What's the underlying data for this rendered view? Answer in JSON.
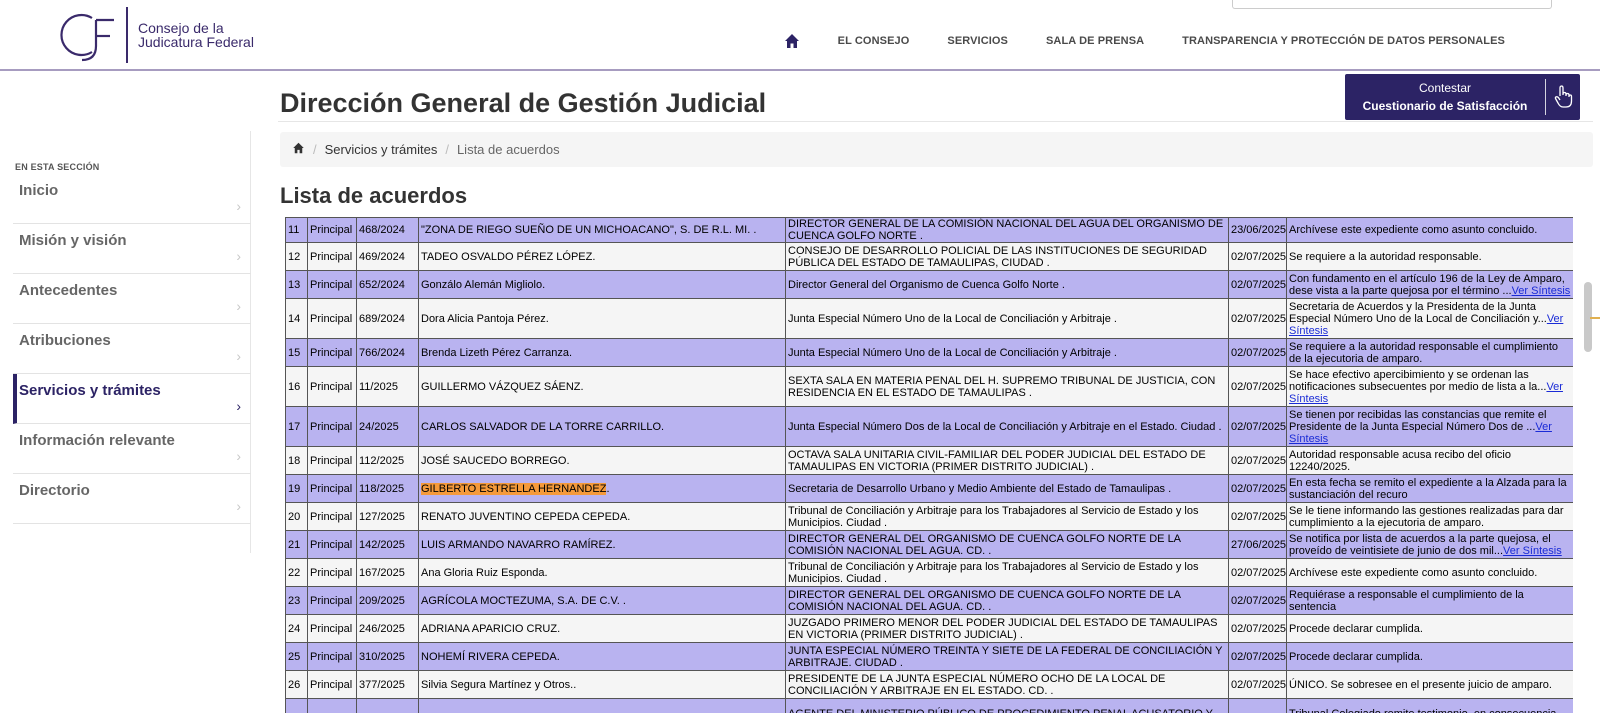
{
  "header": {
    "logo_line1": "Consejo de la",
    "logo_line2": "Judicatura Federal",
    "nav": [
      "EL CONSEJO",
      "SERVICIOS",
      "SALA DE PRENSA",
      "TRANSPARENCIA Y PROTECCIÓN DE DATOS PERSONALES"
    ]
  },
  "page_title": "Dirección General de Gestión Judicial",
  "survey_button": {
    "line1": "Contestar",
    "line2": "Cuestionario de Satisfacción"
  },
  "breadcrumb": {
    "item1": "Servicios y trámites",
    "item2": "Lista de acuerdos"
  },
  "section_title": "Lista de acuerdos",
  "sidebar": {
    "label": "EN ESTA SECCIÓN",
    "items": [
      "Inicio",
      "Misión y visión",
      "Antecedentes",
      "Atribuciones",
      "Servicios y trámites",
      "Información relevante",
      "Directorio"
    ],
    "active_index": 4
  },
  "table": {
    "rows": [
      {
        "n": "11",
        "tipo": "Principal",
        "exp": "468/2024",
        "parte": "\"ZONA DE RIEGO SUEÑO DE UN MICHOACANO\", S. DE R.L. MI. .",
        "autoridad": "DIRECTOR GENERAL DE LA COMISIÓN NACIONAL DEL AGUA DEL ORGANISMO DE CUENCA GOLFO NORTE .",
        "fecha": "23/06/2025",
        "sintesis": "Archívese este expediente como asunto concluido.",
        "link": ""
      },
      {
        "n": "12",
        "tipo": "Principal",
        "exp": "469/2024",
        "parte": "TADEO OSVALDO PÉREZ LÓPEZ.",
        "autoridad": "CONSEJO DE DESARROLLO POLICIAL DE LAS INSTITUCIONES DE SEGURIDAD PÚBLICA DEL ESTADO DE TAMAULIPAS, CIUDAD .",
        "fecha": "02/07/2025",
        "sintesis": "Se requiere a la autoridad responsable.",
        "link": ""
      },
      {
        "n": "13",
        "tipo": "Principal",
        "exp": "652/2024",
        "parte": "Gonzálo Alemán Migliolo.",
        "autoridad": "Director General del Organismo de Cuenca Golfo Norte .",
        "fecha": "02/07/2025",
        "sintesis": "Con fundamento en el artículo 196 de la Ley de Amparo, dese vista a la parte quejosa por el término ...",
        "link": "Ver Síntesis"
      },
      {
        "n": "14",
        "tipo": "Principal",
        "exp": "689/2024",
        "parte": "Dora Alicia Pantoja Pérez.",
        "autoridad": "Junta Especial Número Uno de la Local de Conciliación y Arbitraje .",
        "fecha": "02/07/2025",
        "sintesis": "Secretaria de Acuerdos y la Presidenta de la Junta Especial Número Uno de la Local de Conciliación y...",
        "link": "Ver Síntesis"
      },
      {
        "n": "15",
        "tipo": "Principal",
        "exp": "766/2024",
        "parte": "Brenda Lizeth Pérez Carranza.",
        "autoridad": "Junta Especial Número Uno de la Local de Conciliación y Arbitraje .",
        "fecha": "02/07/2025",
        "sintesis": "Se requiere a la autoridad responsable el cumplimiento de la ejecutoria de amparo.",
        "link": ""
      },
      {
        "n": "16",
        "tipo": "Principal",
        "exp": "11/2025",
        "parte": "GUILLERMO VÁZQUEZ SÁENZ.",
        "autoridad": "SEXTA SALA EN MATERIA PENAL DEL H. SUPREMO TRIBUNAL DE JUSTICIA, CON RESIDENCIA EN EL ESTADO DE TAMAULIPAS .",
        "fecha": "02/07/2025",
        "sintesis": "Se hace efectivo apercibimiento y se ordenan las notificaciones subsecuentes por medio de lista a la...",
        "link": "Ver Síntesis"
      },
      {
        "n": "17",
        "tipo": "Principal",
        "exp": "24/2025",
        "parte": "CARLOS SALVADOR DE LA TORRE CARRILLO.",
        "autoridad": "Junta Especial Número Dos de la Local de Conciliación y Arbitraje en el Estado. Ciudad .",
        "fecha": "02/07/2025",
        "sintesis": "Se tienen por recibidas las constancias que remite el Presidente de la Junta Especial Número Dos de ...",
        "link": "Ver Síntesis"
      },
      {
        "n": "18",
        "tipo": "Principal",
        "exp": "112/2025",
        "parte": "JOSÉ SAUCEDO BORREGO.",
        "autoridad": "OCTAVA SALA UNITARIA CIVIL-FAMILIAR DEL PODER JUDICIAL DEL ESTADO DE TAMAULIPAS EN VICTORIA (PRIMER DISTRITO JUDICIAL) .",
        "fecha": "02/07/2025",
        "sintesis": "Autoridad responsable acusa recibo del oficio 12240/2025.",
        "link": ""
      },
      {
        "n": "19",
        "tipo": "Principal",
        "exp": "118/2025",
        "parte": "GILBERTO ESTRELLA HERNANDEZ.",
        "autoridad": "Secretaria de Desarrollo Urbano y Medio Ambiente del Estado de Tamaulipas .",
        "fecha": "02/07/2025",
        "sintesis": "En esta fecha se remito el expediente a la Alzada para la sustanciación del recuro",
        "link": "",
        "highlight": "GILBERTO ESTRELLA HERNANDEZ"
      },
      {
        "n": "20",
        "tipo": "Principal",
        "exp": "127/2025",
        "parte": "RENATO JUVENTINO CEPEDA CEPEDA.",
        "autoridad": "Tribunal de Conciliación y Arbitraje para los Trabajadores al Servicio de Estado y los Municipios. Ciudad .",
        "fecha": "02/07/2025",
        "sintesis": "Se le tiene informando las gestiones realizadas para dar cumplimiento a la ejecutoria de amparo.",
        "link": ""
      },
      {
        "n": "21",
        "tipo": "Principal",
        "exp": "142/2025",
        "parte": "LUIS ARMANDO NAVARRO RAMÍREZ.",
        "autoridad": "DIRECTOR GENERAL DEL ORGANISMO DE CUENCA GOLFO NORTE DE LA COMISIÓN NACIONAL DEL AGUA. CD. .",
        "fecha": "27/06/2025",
        "sintesis": "Se notifica por lista de acuerdos a la parte quejosa, el proveído de veintisiete de junio de dos mil...",
        "link": "Ver Síntesis"
      },
      {
        "n": "22",
        "tipo": "Principal",
        "exp": "167/2025",
        "parte": "Ana Gloria Ruiz Esponda.",
        "autoridad": "Tribunal de Conciliación y Arbitraje para los Trabajadores al Servicio de Estado y los Municipios. Ciudad .",
        "fecha": "02/07/2025",
        "sintesis": "Archívese este expediente como asunto concluido.",
        "link": ""
      },
      {
        "n": "23",
        "tipo": "Principal",
        "exp": "209/2025",
        "parte": "AGRÍCOLA MOCTEZUMA, S.A. DE C.V. .",
        "autoridad": "DIRECTOR GENERAL DEL ORGANISMO DE CUENCA GOLFO NORTE DE LA COMISIÓN NACIONAL DEL AGUA. CD. .",
        "fecha": "02/07/2025",
        "sintesis": "Requiérase a responsable el cumplimiento de la sentencia",
        "link": ""
      },
      {
        "n": "24",
        "tipo": "Principal",
        "exp": "246/2025",
        "parte": "ADRIANA APARICIO CRUZ.",
        "autoridad": "JUZGADO PRIMERO MENOR DEL PODER JUDICIAL DEL ESTADO DE TAMAULIPAS EN VICTORIA (PRIMER DISTRITO JUDICIAL) .",
        "fecha": "02/07/2025",
        "sintesis": "Procede declarar cumplida.",
        "link": ""
      },
      {
        "n": "25",
        "tipo": "Principal",
        "exp": "310/2025",
        "parte": "NOHEMÍ RIVERA CEPEDA.",
        "autoridad": "JUNTA ESPECIAL NÚMERO TREINTA Y SIETE DE LA FEDERAL DE CONCILIACIÓN Y ARBITRAJE. CIUDAD .",
        "fecha": "02/07/2025",
        "sintesis": "Procede declarar cumplida.",
        "link": ""
      },
      {
        "n": "26",
        "tipo": "Principal",
        "exp": "377/2025",
        "parte": "Silvia Segura Martínez y Otros..",
        "autoridad": "PRESIDENTE DE LA JUNTA ESPECIAL NÚMERO OCHO DE LA LOCAL DE CONCILIACIÓN Y ARBITRAJE EN EL ESTADO. CD. .",
        "fecha": "02/07/2025",
        "sintesis": "ÚNICO. Se sobresee en el presente juicio de amparo.",
        "link": ""
      },
      {
        "n": "",
        "tipo": "",
        "exp": "",
        "parte": "",
        "autoridad": "AGENTE DEL MINISTERIO PÚBLICO DE PROCEDIMIENTO PENAL ACUSATORIO Y",
        "fecha": "",
        "sintesis": "Tribunal Colegiado remite testimonio, en consecuencia",
        "link": ""
      }
    ],
    "row_heights": [
      24,
      28,
      28,
      40,
      28,
      40,
      40,
      28,
      28,
      28,
      28,
      28,
      28,
      28,
      28,
      28,
      30
    ]
  }
}
